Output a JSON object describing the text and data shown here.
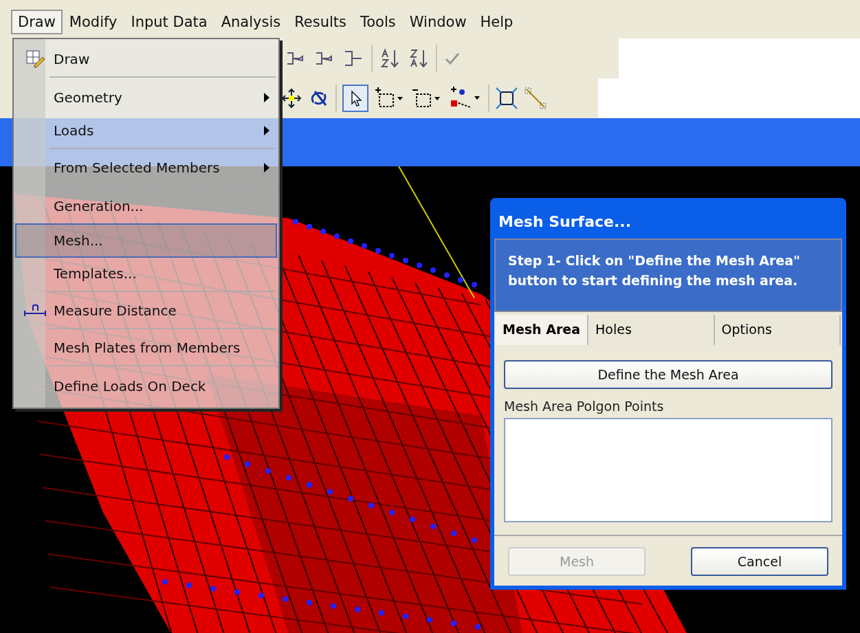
{
  "menubar": [
    {
      "label": "Draw",
      "selected": true
    },
    {
      "label": "Modify",
      "selected": false
    },
    {
      "label": "Input Data",
      "selected": false
    },
    {
      "label": "Analysis",
      "selected": false
    },
    {
      "label": "Results",
      "selected": false
    },
    {
      "label": "Tools",
      "selected": false
    },
    {
      "label": "Window",
      "selected": false
    },
    {
      "label": "Help",
      "selected": false
    }
  ],
  "menu": [
    {
      "label": "Draw",
      "kind": "draw",
      "submenu": false,
      "selected": false,
      "separator_after": true
    },
    {
      "label": "Geometry",
      "kind": "plain",
      "submenu": true,
      "selected": false,
      "separator_after": false
    },
    {
      "label": "Loads",
      "kind": "plain",
      "submenu": true,
      "selected": false,
      "separator_after": true
    },
    {
      "label": "From Selected Members",
      "kind": "plain",
      "submenu": true,
      "selected": false,
      "separator_after": true
    },
    {
      "label": "Generation...",
      "kind": "plain",
      "submenu": false,
      "selected": false,
      "separator_after": false
    },
    {
      "label": "Mesh...",
      "kind": "plain",
      "submenu": false,
      "selected": true,
      "separator_after": false
    },
    {
      "label": "Templates...",
      "kind": "plain",
      "submenu": false,
      "selected": false,
      "separator_after": true
    },
    {
      "label": "Measure Distance",
      "kind": "measure",
      "submenu": false,
      "selected": false,
      "separator_after": true
    },
    {
      "label": "Mesh Plates from Members",
      "kind": "plain",
      "submenu": false,
      "selected": false,
      "separator_after": true
    },
    {
      "label": "Define Loads On Deck",
      "kind": "plain",
      "submenu": false,
      "selected": false,
      "separator_after": false
    }
  ],
  "dialog": {
    "title": "Mesh Surface...",
    "instructions": "Step 1- Click on \"Define the Mesh Area\" button to start defining the mesh area.",
    "tabs": [
      {
        "label": "Mesh Area",
        "selected": true
      },
      {
        "label": "Holes",
        "selected": false
      },
      {
        "label": "Options",
        "selected": false
      }
    ],
    "define_button": "Define the Mesh Area",
    "points_label": "Mesh Area Polgon Points",
    "buttons": [
      {
        "label": "Mesh",
        "disabled": true
      },
      {
        "label": "Cancel",
        "disabled": false
      }
    ]
  }
}
